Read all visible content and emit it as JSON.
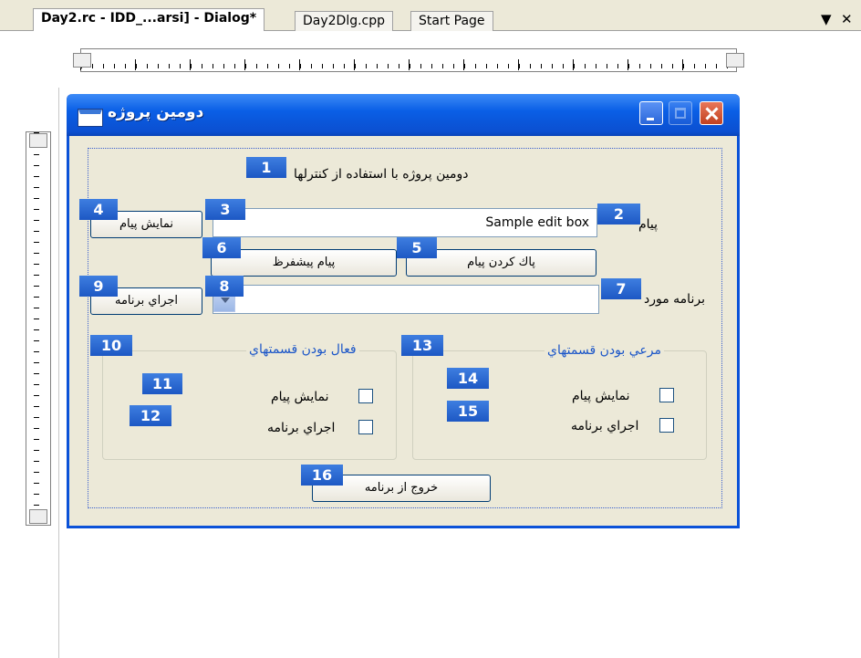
{
  "tabs": [
    {
      "label": "Day2.rc - IDD_...arsi] - Dialog*",
      "active": true
    },
    {
      "label": "Day2Dlg.cpp",
      "active": false
    },
    {
      "label": "Start Page",
      "active": false
    }
  ],
  "tab_controls": {
    "dropdown_icon": "▼",
    "close_icon": "✕"
  },
  "dialog": {
    "title": "دومين پروژه",
    "static_text": "دومين پروژه با استفاده از کنترلها",
    "message_label": "پيام",
    "edit_value": "Sample edit box",
    "target_label": "برنامه مورد",
    "buttons": {
      "show_message": "نمايش پيام",
      "clear_message": "پاك كردن پيام",
      "default_message": "پيام پيشفرظ",
      "run_program": "اجراي برنامه",
      "exit": "خروج از برنامه"
    },
    "group_enable": {
      "caption": "فعال بودن قسمتهاي",
      "show_message": "نمايش پيام",
      "run_program": "اجراي برنامه"
    },
    "group_visible": {
      "caption": "مرعي بودن قسمتهاي",
      "show_message": "نمايش پيام",
      "run_program": "اجراي برنامه"
    }
  },
  "tab_order_badges": [
    "1",
    "2",
    "3",
    "4",
    "5",
    "6",
    "7",
    "8",
    "9",
    "10",
    "11",
    "12",
    "13",
    "14",
    "15",
    "16"
  ],
  "colors": {
    "titlebar": "#0b4fd0",
    "badge": "#2c68d2",
    "dialog_face": "#ece9d8",
    "group_caption": "#1a55c8"
  }
}
